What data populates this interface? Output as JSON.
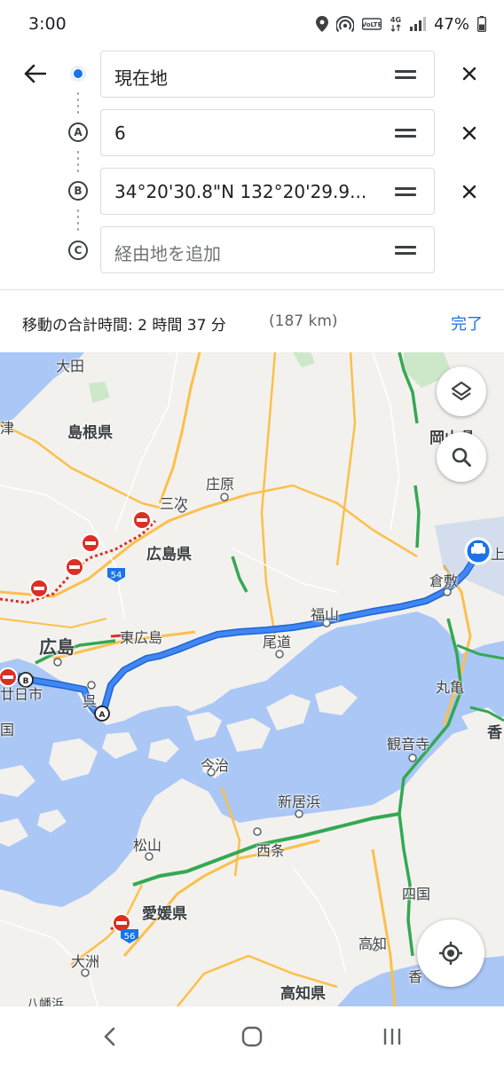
{
  "status_bar": {
    "time": "3:00",
    "network": "4G",
    "volte": "VoLTE",
    "battery": "47%"
  },
  "route": {
    "back_icon": "arrow-left-icon",
    "stops": [
      {
        "marker": "origin",
        "text": "現在地",
        "removable": true
      },
      {
        "marker": "A",
        "text": "6",
        "removable": true
      },
      {
        "marker": "B",
        "text": "34°20'30.8\"N 132°20'29.9...",
        "removable": true
      },
      {
        "marker": "C",
        "text": "経由地を追加",
        "placeholder": true
      }
    ]
  },
  "summary": {
    "total_label": "移動の合計時間: 2 時間 37 分",
    "distance": "(187 km)",
    "done": "完了"
  },
  "map": {
    "labels": {
      "ota": "大田",
      "shimane": "島根県",
      "miyoshi": "三次",
      "shobara": "庄原",
      "hiroshima_pref": "広島県",
      "okayama_pref": "岡山県",
      "route54": "54",
      "kurashiki": "倉敷",
      "fukuyama": "福山",
      "higashihiroshima": "東広島",
      "hiroshima": "広島",
      "onomichi": "尾道",
      "hatsukaichi": "廿日市",
      "kure": "呉",
      "marugame": "丸亀",
      "kagawa": "香",
      "kanonji": "観音寺",
      "imabari": "今治",
      "niihama": "新居浜",
      "saijo": "西条",
      "matsuyama": "松山",
      "ehime": "愛媛県",
      "route56": "56",
      "shikokuchuo": "四国",
      "kochi": "高知",
      "kochi_pref": "高知県",
      "ozu": "大洲",
      "yawatahama": "八幡浜",
      "kounan": "香",
      "tsu": "津",
      "kei": "県",
      "koku": "国",
      "kami": "上"
    },
    "waypoints": {
      "a": "A",
      "b": "B"
    },
    "buttons": {
      "layers": "layers-icon",
      "search": "search-icon",
      "locate": "my-location-icon"
    }
  },
  "nav": {
    "back": "nav-back-icon",
    "home": "nav-home-icon",
    "recents": "nav-recents-icon"
  },
  "colors": {
    "route": "#4285f4",
    "route_outline": "#1967d2",
    "water": "#aac7f6",
    "land": "#f3f1ed",
    "highway": "#fbc04c",
    "traffic_green": "#34a853",
    "closure_red": "#d93025",
    "accent": "#1a73e8"
  }
}
